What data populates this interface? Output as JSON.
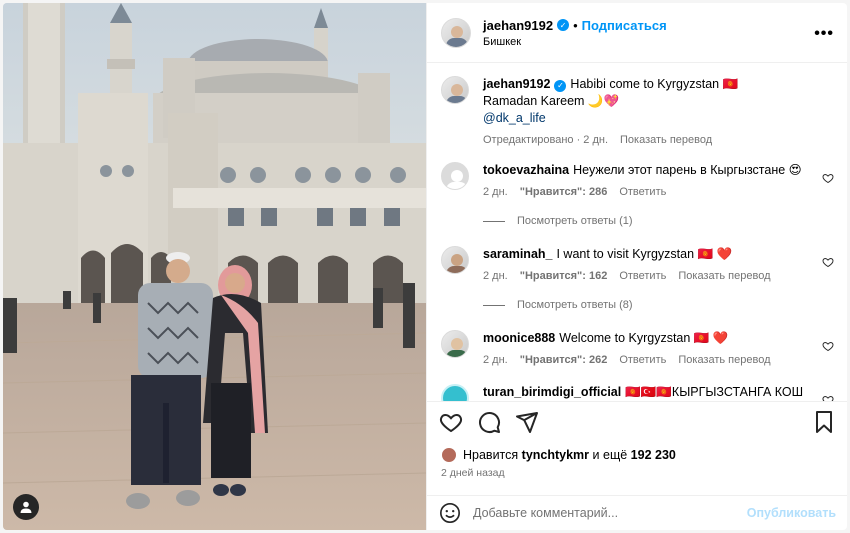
{
  "post": {
    "author": "jaehan9192",
    "follow_label": "Подписаться",
    "separator": "•",
    "location": "Бишкек",
    "more_label": "•••"
  },
  "caption": {
    "author": "jaehan9192",
    "line1": "Habibi come to Kyrgyzstan 🇰🇬",
    "line2": "Ramadan Kareem 🌙💖",
    "mention": "@dk_a_life",
    "edited_time": "Отредактировано · 2 дн.",
    "translate": "Показать перевод"
  },
  "comments": [
    {
      "author": "tokoevazhaina",
      "text": "Неужели этот парень в Кыргызстане 😍",
      "time": "2 дн.",
      "likes": "\"Нравится\": 286",
      "reply": "Ответить",
      "translate": "",
      "view_replies": "Посмотреть ответы (1)"
    },
    {
      "author": "saraminah_",
      "text": "I want to visit Kyrgyzstan 🇰🇬 ❤️",
      "time": "2 дн.",
      "likes": "\"Нравится\": 162",
      "reply": "Ответить",
      "translate": "Показать перевод",
      "view_replies": "Посмотреть ответы (8)"
    },
    {
      "author": "moonice888",
      "text": "Welcome to Kyrgyzstan 🇰🇬 ❤️",
      "time": "2 дн.",
      "likes": "\"Нравится\": 262",
      "reply": "Ответить",
      "translate": "Показать перевод",
      "view_replies": ""
    },
    {
      "author": "turan_birimdigi_official",
      "text": "🇰🇬🇹🇷🇰🇬КЫРГЫЗСТАНГА КОШ",
      "time": "",
      "likes": "",
      "reply": "",
      "translate": "",
      "view_replies": ""
    }
  ],
  "likes_bar": {
    "prefix": "Нравится",
    "user": "tynchtykmr",
    "middle": "и ещё",
    "count": "192 230",
    "ago": "2 дней назад"
  },
  "add_comment": {
    "placeholder": "Добавьте комментарий...",
    "publish": "Опубликовать"
  },
  "colors": {
    "accent": "#0095f6",
    "muted": "#737373",
    "publish_disabled": "#b2dffc"
  }
}
